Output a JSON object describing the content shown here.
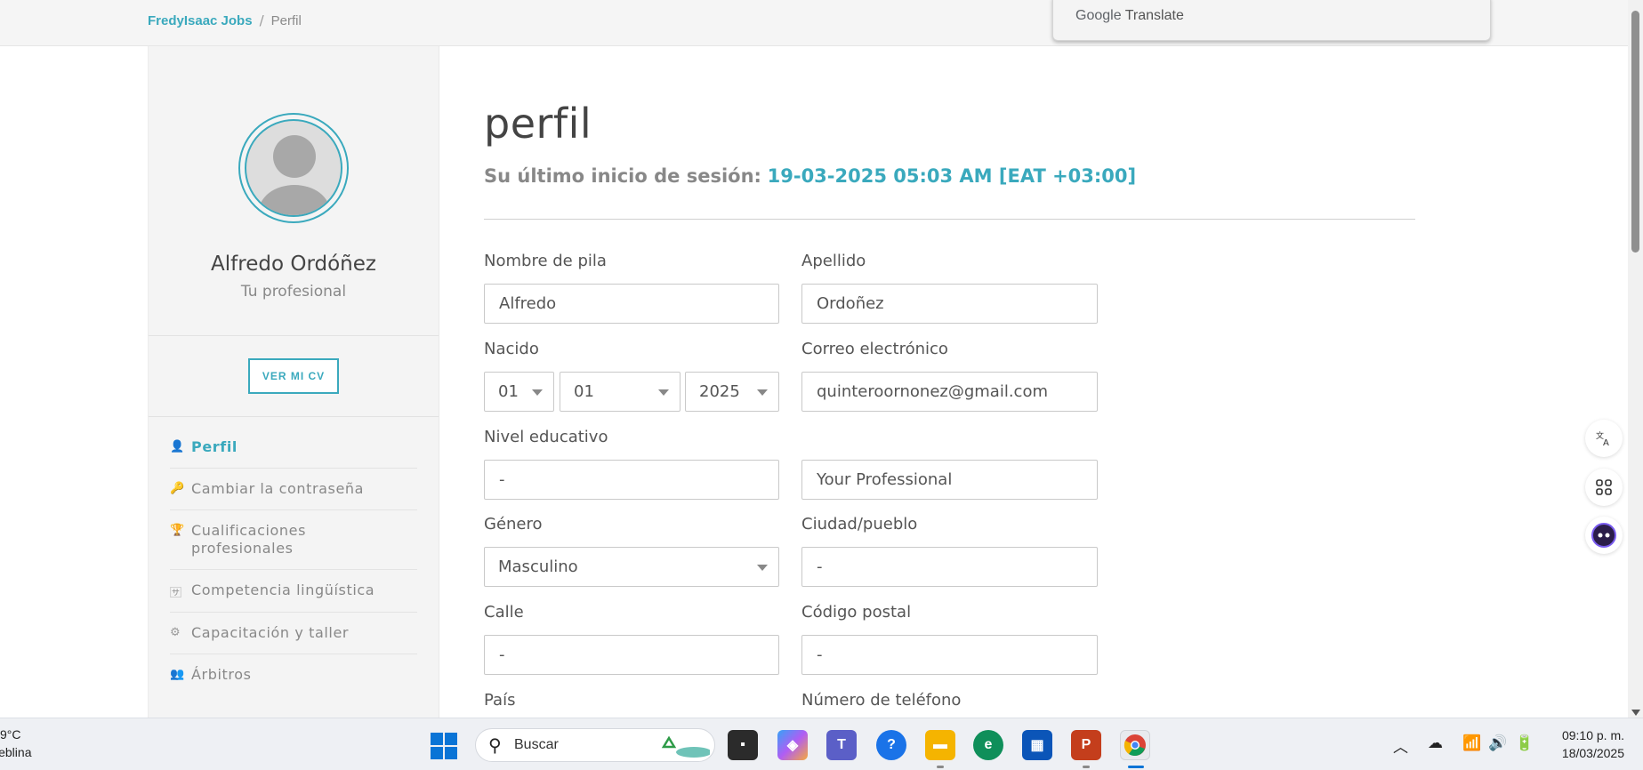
{
  "breadcrumb": {
    "home": "FredyIsaac Jobs",
    "separator": "/",
    "current": "Perfil"
  },
  "translate": {
    "brand": "Google",
    "label": "Translate"
  },
  "profile": {
    "name": "Alfredo Ordóñez",
    "role": "Tu profesional",
    "cv_button": "VER MI CV"
  },
  "menu": [
    {
      "icon": "user-icon",
      "glyph": "👤",
      "label": "Perfil",
      "active": true
    },
    {
      "icon": "key-icon",
      "glyph": "🔑",
      "label": "Cambiar la contraseña"
    },
    {
      "icon": "trophy-icon",
      "glyph": "🏆",
      "label": "Cualificaciones profesionales"
    },
    {
      "icon": "language-icon",
      "glyph": "🈂",
      "label": "Competencia lingüística"
    },
    {
      "icon": "gears-icon",
      "glyph": "⚙",
      "label": "Capacitación y taller"
    },
    {
      "icon": "users-icon",
      "glyph": "👥",
      "label": "Árbitros"
    }
  ],
  "main": {
    "title": "perfil",
    "last_login_label": "Su último inicio de sesión:",
    "last_login_value": "19-03-2025 05:03 AM [EAT +03:00]"
  },
  "form": {
    "first_name": {
      "label": "Nombre de pila",
      "value": "Alfredo"
    },
    "last_name": {
      "label": "Apellido",
      "value": "Ordoñez"
    },
    "birth": {
      "label": "Nacido",
      "day": "01",
      "month": "01",
      "year": "2025"
    },
    "email": {
      "label": "Correo electrónico",
      "value": "quinteroornonez@gmail.com"
    },
    "education": {
      "label": "Nivel educativo",
      "value": "-"
    },
    "title_field": {
      "value": "Your Professional"
    },
    "gender": {
      "label": "Género",
      "value": "Masculino"
    },
    "city": {
      "label": "Ciudad/pueblo",
      "value": "-"
    },
    "street": {
      "label": "Calle",
      "value": "-"
    },
    "postal": {
      "label": "Código postal",
      "value": "-"
    },
    "country": {
      "label": "País"
    },
    "phone": {
      "label": "Número de teléfono"
    }
  },
  "taskbar": {
    "weather_temp": "9°C",
    "weather_desc": "Neblina",
    "search_placeholder": "Buscar",
    "time": "09:10 p. m.",
    "date": "18/03/2025"
  }
}
